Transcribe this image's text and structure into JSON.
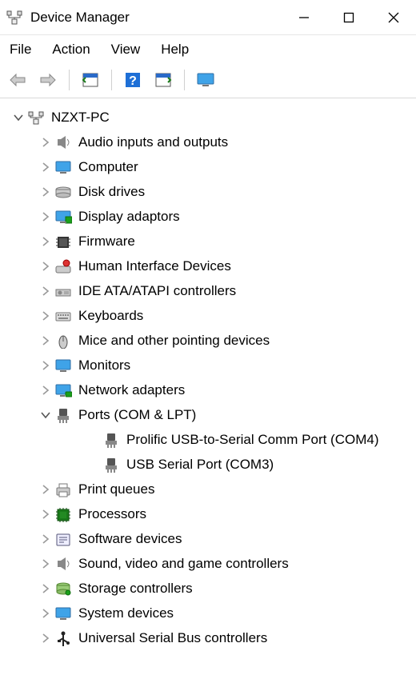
{
  "window": {
    "title": "Device Manager"
  },
  "menu": {
    "file": "File",
    "action": "Action",
    "view": "View",
    "help": "Help"
  },
  "toolbar_icons": {
    "back": "back-arrow-icon",
    "forward": "forward-arrow-icon",
    "show_hide": "calendar-page-icon",
    "help": "help-question-icon",
    "scan": "scan-hardware-icon",
    "monitor": "monitor-icon"
  },
  "tree": {
    "root": {
      "label": "NZXT-PC",
      "expanded": true,
      "icon": "computer-tower-icon"
    },
    "categories": [
      {
        "id": "audio",
        "label": "Audio inputs and outputs",
        "icon": "speaker-icon",
        "expanded": false
      },
      {
        "id": "computer",
        "label": "Computer",
        "icon": "monitor-icon",
        "expanded": false
      },
      {
        "id": "disk",
        "label": "Disk drives",
        "icon": "drive-icon",
        "expanded": false
      },
      {
        "id": "display",
        "label": "Display adaptors",
        "icon": "display-adapter-icon",
        "expanded": false
      },
      {
        "id": "firmware",
        "label": "Firmware",
        "icon": "chip-icon",
        "expanded": false
      },
      {
        "id": "hid",
        "label": "Human Interface Devices",
        "icon": "hid-icon",
        "expanded": false
      },
      {
        "id": "ide",
        "label": "IDE ATA/ATAPI controllers",
        "icon": "ide-icon",
        "expanded": false
      },
      {
        "id": "keyboards",
        "label": "Keyboards",
        "icon": "keyboard-icon",
        "expanded": false
      },
      {
        "id": "mice",
        "label": "Mice and other pointing devices",
        "icon": "mouse-icon",
        "expanded": false
      },
      {
        "id": "monitors",
        "label": "Monitors",
        "icon": "monitor-icon",
        "expanded": false
      },
      {
        "id": "network",
        "label": "Network adapters",
        "icon": "network-icon",
        "expanded": false
      },
      {
        "id": "ports",
        "label": "Ports (COM & LPT)",
        "icon": "port-icon",
        "expanded": true,
        "children": [
          {
            "label": "Prolific USB-to-Serial Comm Port (COM4)",
            "icon": "port-icon"
          },
          {
            "label": "USB Serial Port (COM3)",
            "icon": "port-icon"
          }
        ]
      },
      {
        "id": "printq",
        "label": "Print queues",
        "icon": "printer-icon",
        "expanded": false
      },
      {
        "id": "processors",
        "label": "Processors",
        "icon": "processor-icon",
        "expanded": false
      },
      {
        "id": "software",
        "label": "Software devices",
        "icon": "software-icon",
        "expanded": false
      },
      {
        "id": "sound",
        "label": "Sound, video and game controllers",
        "icon": "speaker-icon",
        "expanded": false
      },
      {
        "id": "storage",
        "label": "Storage controllers",
        "icon": "storage-ctrl-icon",
        "expanded": false
      },
      {
        "id": "system",
        "label": "System devices",
        "icon": "monitor-icon",
        "expanded": false
      },
      {
        "id": "usb",
        "label": "Universal Serial Bus controllers",
        "icon": "usb-icon",
        "expanded": false
      }
    ]
  }
}
